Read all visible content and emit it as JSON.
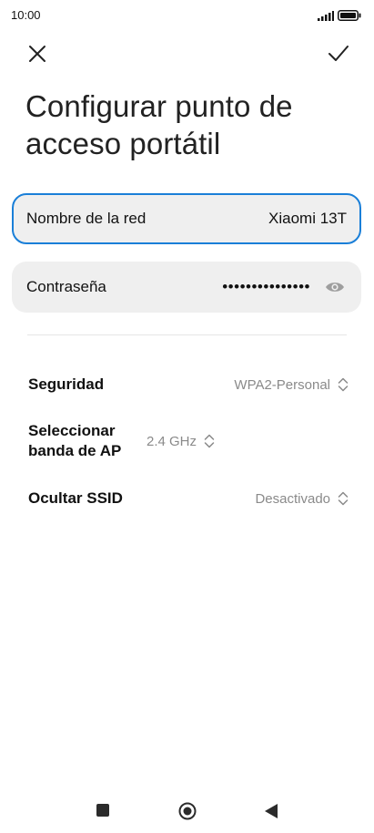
{
  "status_bar": {
    "time": "10:00",
    "icons": [
      "signal-icon",
      "battery-icon"
    ]
  },
  "actions": {
    "close_icon": "close-icon",
    "confirm_icon": "check-icon"
  },
  "title": "Configurar punto de acceso portátil",
  "network_name": {
    "label": "Nombre de la red",
    "value": "Xiaomi 13T"
  },
  "password": {
    "label": "Contraseña",
    "masked_value": "•••••••••••••••",
    "visibility_icon": "eye-icon"
  },
  "settings": [
    {
      "label": "Seguridad",
      "value": "WPA2-Personal",
      "icon": "chevron-updown-icon"
    },
    {
      "label": "Seleccionar banda de AP",
      "value": "2.4 GHz",
      "icon": "chevron-updown-icon"
    },
    {
      "label": "Ocultar SSID",
      "value": "Desactivado",
      "icon": "chevron-updown-icon"
    }
  ],
  "nav_bar": {
    "items": [
      "recents-icon",
      "home-icon",
      "back-icon"
    ]
  },
  "colors": {
    "accent": "#1a7fd8",
    "card_bg": "#efefef",
    "secondary_text": "#8a8a8a"
  }
}
